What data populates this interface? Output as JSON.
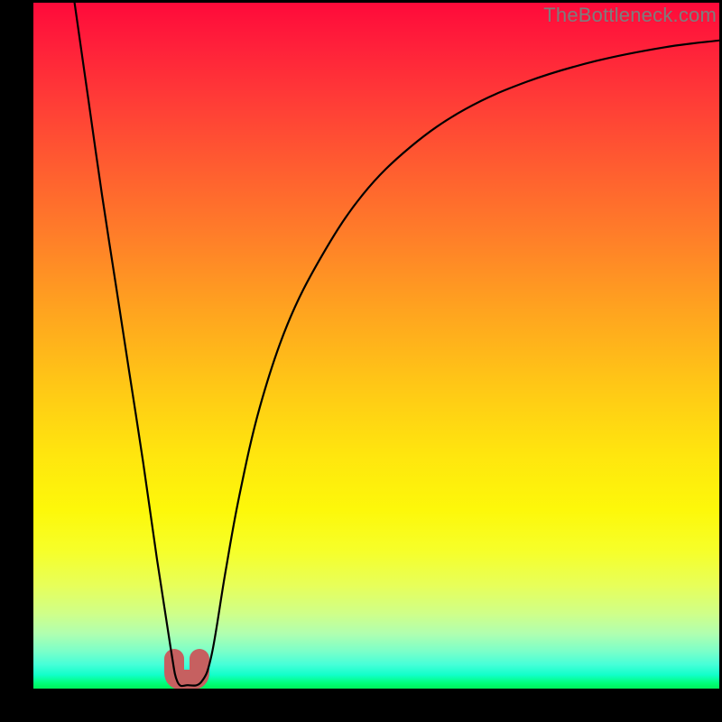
{
  "watermark": "TheBottleneck.com",
  "chart_data": {
    "type": "line",
    "title": "",
    "xlabel": "",
    "ylabel": "",
    "xlim": [
      0,
      100
    ],
    "ylim": [
      0,
      100
    ],
    "grid": false,
    "legend": false,
    "background": "rainbow-vertical-gradient",
    "series": [
      {
        "name": "curve",
        "x": [
          6,
          8,
          10,
          12,
          14,
          16,
          18,
          20,
          21,
          22.5,
          24.5,
          26,
          28,
          30,
          33,
          37,
          42,
          48,
          55,
          63,
          72,
          82,
          92,
          100
        ],
        "values": [
          100,
          86,
          72,
          59,
          46,
          33,
          19,
          6,
          1,
          0.5,
          1,
          5,
          17,
          28,
          41,
          53,
          63,
          72,
          79,
          84.5,
          88.5,
          91.5,
          93.5,
          94.5
        ]
      }
    ],
    "marker": {
      "name": "minimum-u-marker",
      "x_center": 22,
      "color": "#c66060"
    }
  }
}
